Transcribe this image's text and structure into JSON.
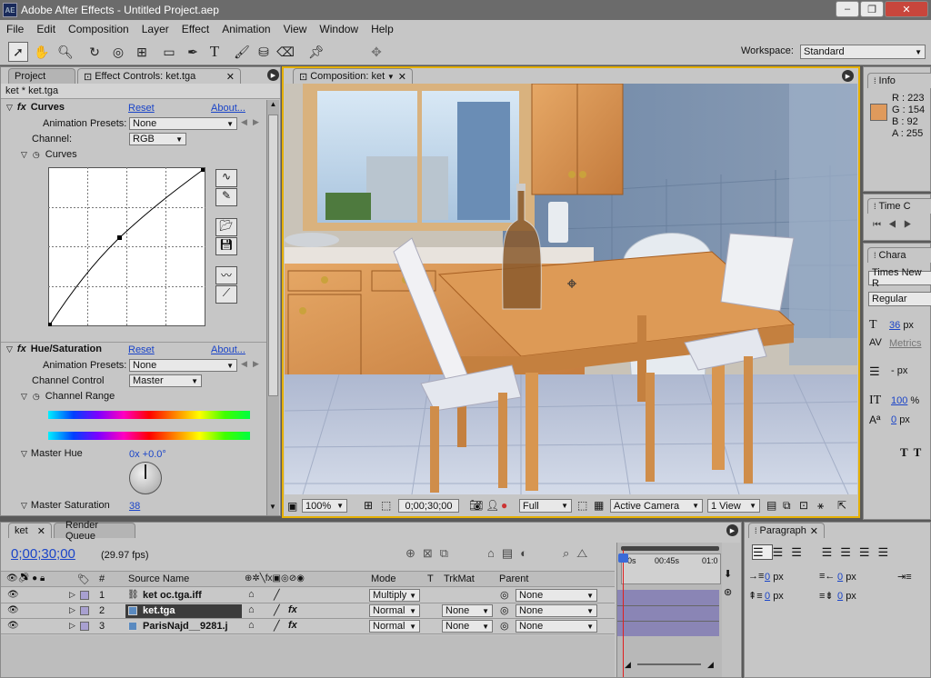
{
  "window": {
    "title": "Adobe After Effects - Untitled Project.aep",
    "logo": "AE",
    "minimize": "–",
    "maximize": "❐",
    "close": "✕"
  },
  "menu": [
    "File",
    "Edit",
    "Composition",
    "Layer",
    "Effect",
    "Animation",
    "View",
    "Window",
    "Help"
  ],
  "workspace": {
    "label": "Workspace:",
    "value": "Standard"
  },
  "left_panel": {
    "tabs": [
      "Project",
      "Effect Controls: ket.tga"
    ],
    "layer_label": "ket * ket.tga",
    "curves": {
      "name": "Curves",
      "reset": "Reset",
      "about": "About...",
      "presets_label": "Animation Presets:",
      "presets_value": "None",
      "channel_label": "Channel:",
      "channel_value": "RGB",
      "curves_label": "Curves"
    },
    "hue": {
      "name": "Hue/Saturation",
      "reset": "Reset",
      "about": "About...",
      "presets_label": "Animation Presets:",
      "presets_value": "None",
      "channel_control_label": "Channel Control",
      "channel_control_value": "Master",
      "channel_range_label": "Channel Range",
      "master_hue_label": "Master Hue",
      "master_hue_value": "0x +0.0°",
      "master_sat_label": "Master Saturation",
      "master_sat_value": "38"
    }
  },
  "comp": {
    "tab": "Composition: ket",
    "zoom": "100%",
    "timecode": "0;00;30;00",
    "resolution": "Full",
    "camera": "Active Camera",
    "views": "1 View"
  },
  "info": {
    "tab": "Info",
    "r": "R : 223",
    "g": "G : 154",
    "b": "B : 92",
    "a": "A : 255",
    "swatch": "#df9a5c"
  },
  "time_panel": {
    "tab": "Time C"
  },
  "character": {
    "tab": "Chara",
    "font": "Times New R",
    "style": "Regular",
    "size": "36",
    "size_unit": "px",
    "kerning": "Metrics",
    "leading_unit": "- px",
    "vscale": "100",
    "vscale_unit": "%",
    "baseline": "0",
    "baseline_unit": "px"
  },
  "paragraph": {
    "tab": "Paragraph",
    "indent_left": "0",
    "indent_right": "0",
    "indent_first": "0",
    "space_before": "0",
    "space_after": "0",
    "unit": "px"
  },
  "timeline": {
    "tabs": [
      "ket",
      "Render Queue"
    ],
    "timecode": "0;00;30;00",
    "fps": "(29.97 fps)",
    "ruler": [
      "0s",
      "00:45s",
      "01:0"
    ],
    "headers": {
      "num": "#",
      "source": "Source Name",
      "mode": "Mode",
      "t": "T",
      "trkmat": "TrkMat",
      "parent": "Parent"
    },
    "layers": [
      {
        "num": "1",
        "name": "ket oc.tga.iff",
        "mode": "Multiply",
        "trkmat": "",
        "parent": "None"
      },
      {
        "num": "2",
        "name": "ket.tga",
        "mode": "Normal",
        "trkmat": "None",
        "parent": "None"
      },
      {
        "num": "3",
        "name": "ParisNajd__9281.j",
        "mode": "Normal",
        "trkmat": "None",
        "parent": "None"
      }
    ]
  }
}
